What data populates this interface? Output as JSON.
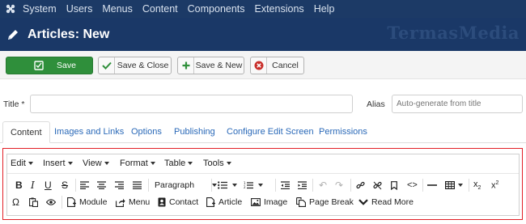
{
  "topbar": {
    "menu": [
      "System",
      "Users",
      "Menus",
      "Content",
      "Components",
      "Extensions",
      "Help"
    ]
  },
  "header": {
    "title": "Articles: New",
    "watermark": "TermasMedia"
  },
  "toolbar": {
    "save": "Save",
    "save_close": "Save & Close",
    "save_new": "Save & New",
    "cancel": "Cancel"
  },
  "form": {
    "title_label": "Title *",
    "alias_label": "Alias",
    "alias_placeholder": "Auto-generate from title"
  },
  "tabs": [
    "Content",
    "Images and Links",
    "Options",
    "Publishing",
    "Configure Edit Screen",
    "Permissions"
  ],
  "editor": {
    "menu": [
      "Edit",
      "Insert",
      "View",
      "Format",
      "Table",
      "Tools"
    ],
    "format_select": "Paragraph",
    "buttons": {
      "module": "Module",
      "menu": "Menu",
      "contact": "Contact",
      "article": "Article",
      "image": "Image",
      "page_break": "Page Break",
      "read_more": "Read More"
    }
  },
  "colors": {
    "topbar": "#1c3a66",
    "header": "#1a3867",
    "save_button": "#2f8f3b",
    "tab_link": "#2a69b8",
    "highlight": "#e21f26"
  },
  "icons": [
    "joomla-icon",
    "pencil-icon",
    "check-icon",
    "plus-icon",
    "cancel-icon"
  ]
}
